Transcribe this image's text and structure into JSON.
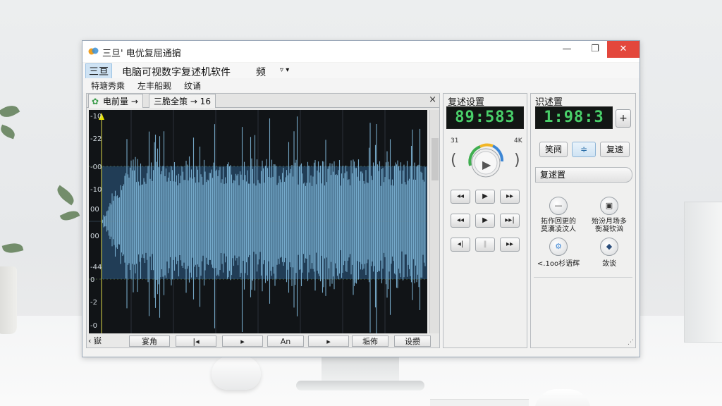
{
  "window": {
    "title": "三旦' 电优复屈通掮",
    "minimize": "—",
    "maximize": "❐",
    "close": "✕"
  },
  "menu": {
    "items": [
      "三亘",
      "电脑可视数字复述机软件",
      "频",
      "▿ ▾"
    ]
  },
  "toolbar2": {
    "items": [
      "特瑭秀乘",
      "左丰船觋",
      "纹诵"
    ]
  },
  "waveform": {
    "tabs": [
      "电前量 →",
      "三脆全策 → 16"
    ],
    "tab_close": "×",
    "y_labels": [
      "-10",
      "-22",
      "-00",
      "-10",
      "00",
      "00",
      "-44",
      "0",
      "-2",
      "-0"
    ],
    "waveform_color": "#7fb6d8",
    "background_color": "#111417",
    "marker_color": "#e8e400"
  },
  "transport": {
    "buttons": [
      "‹ 嶽",
      "宴角",
      "|◂",
      "▸",
      "An",
      "▸",
      "垢佈",
      "设攒"
    ]
  },
  "playback_panel": {
    "title": "复述设置",
    "display": "89:583",
    "left_label": "31",
    "right_label": "4K",
    "open_paren": "(",
    "close_paren": ")",
    "play_icon": "▶",
    "button_rows": [
      [
        "◂◂",
        "▶",
        "▸▸"
      ],
      [
        "◂◂",
        "▶",
        "▸▸|"
      ],
      [
        "◂|",
        "‖",
        "▸▸"
      ]
    ]
  },
  "settings_panel": {
    "title": "识述置",
    "display": "1:98:3",
    "side_button": "+",
    "buttons": [
      "笑阋",
      "≑",
      "复速"
    ],
    "section_title": "复逑置",
    "icons": [
      {
        "symbol": "—",
        "caption_1": "拓作回更的",
        "caption_2": "莫瀵凌汶人"
      },
      {
        "symbol": "▣",
        "caption_1": "殆汾月场多",
        "caption_2": "衡凝钦汹"
      },
      {
        "symbol": "⚙",
        "caption_1": "<.1oo杉语辉",
        "caption_2": ""
      },
      {
        "symbol": "◆",
        "caption_1": "敛谈",
        "caption_2": ""
      }
    ]
  }
}
